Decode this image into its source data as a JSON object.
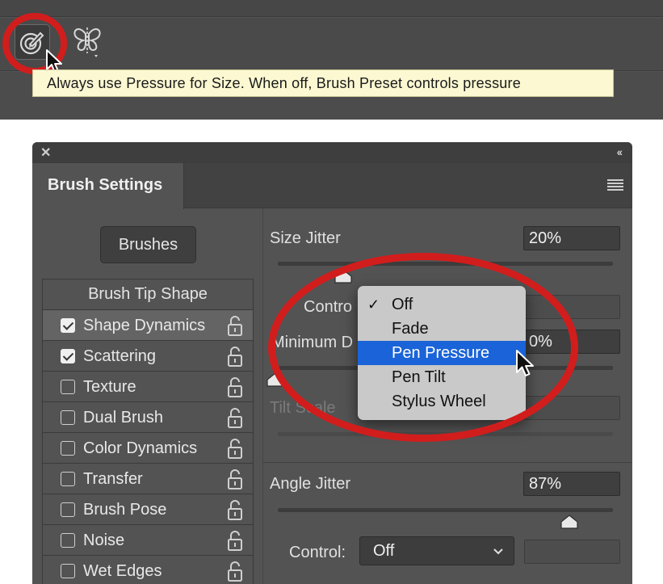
{
  "toolbar": {
    "pressure_tool_icon": "pressure-for-size-icon",
    "symmetry_tool_icon": "butterfly-symmetry-icon",
    "tooltip": "Always use Pressure for Size. When off, Brush Preset controls pressure"
  },
  "panel": {
    "close_glyph": "✕",
    "collapse_glyph": "‹‹",
    "tab_title": "Brush Settings",
    "brushes_button": "Brushes",
    "list_header": "Brush Tip Shape",
    "items": [
      {
        "label": "Shape Dynamics",
        "checked": true
      },
      {
        "label": "Scattering",
        "checked": true
      },
      {
        "label": "Texture",
        "checked": false
      },
      {
        "label": "Dual Brush",
        "checked": false
      },
      {
        "label": "Color Dynamics",
        "checked": false
      },
      {
        "label": "Transfer",
        "checked": false
      },
      {
        "label": "Brush Pose",
        "checked": false
      },
      {
        "label": "Noise",
        "checked": false
      },
      {
        "label": "Wet Edges",
        "checked": false
      }
    ],
    "size_jitter_label": "Size Jitter",
    "size_jitter_value": "20%",
    "control_label_partial": "Contro",
    "minimum_diameter_label_partial": "Minimum D",
    "minimum_diameter_value": "0%",
    "tilt_scale_label": "Tilt Scale",
    "angle_jitter_label": "Angle Jitter",
    "angle_jitter_value": "87%",
    "angle_jitter_level": 0.87,
    "control_label": "Control:",
    "control_select_value": "Off"
  },
  "dropdown": {
    "options": [
      "Off",
      "Fade",
      "Pen Pressure",
      "Pen Tilt",
      "Stylus Wheel"
    ],
    "checked": "Off",
    "highlighted": "Pen Pressure",
    "checkmark_glyph": "✓"
  },
  "colors": {
    "highlight": "#1a63d8",
    "annotation_red": "#d21d1d",
    "tooltip_bg": "#fbf8d2",
    "panel_bg": "#535353"
  }
}
